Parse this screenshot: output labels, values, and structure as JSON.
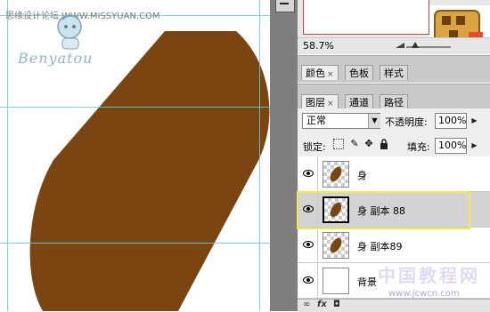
{
  "canvas": {
    "watermark_text": "思缘设计论坛 WWW.MISSYUAN.COM",
    "logo_text": "Benyatou",
    "shape_color": "#7a4511"
  },
  "navigator": {
    "zoom": "58.7%"
  },
  "color_panel": {
    "tabs": [
      {
        "label": "颜色",
        "close": "×",
        "active": true
      },
      {
        "label": "色板",
        "close": "",
        "active": false
      },
      {
        "label": "样式",
        "close": "",
        "active": false
      }
    ]
  },
  "layers_panel": {
    "tabs": [
      {
        "label": "图层",
        "close": "×",
        "active": true
      },
      {
        "label": "通道",
        "close": "",
        "active": false
      },
      {
        "label": "路径",
        "close": "",
        "active": false
      }
    ],
    "blend_mode": "正常",
    "opacity_label": "不透明度:",
    "opacity_value": "100%",
    "lock_label": "锁定:",
    "fill_label": "填充:",
    "fill_value": "100%",
    "layers": [
      {
        "name": "身",
        "thumb": "shape",
        "selected": false
      },
      {
        "name": "身 副本 88",
        "thumb": "shape",
        "selected": true
      },
      {
        "name": "身 副本89",
        "thumb": "shape",
        "selected": false
      },
      {
        "name": "背景",
        "thumb": "plain",
        "selected": false
      }
    ],
    "footer_fx": "fx"
  },
  "site_watermark": {
    "text": "中国教程网",
    "url": "www.jcwcn.com"
  }
}
